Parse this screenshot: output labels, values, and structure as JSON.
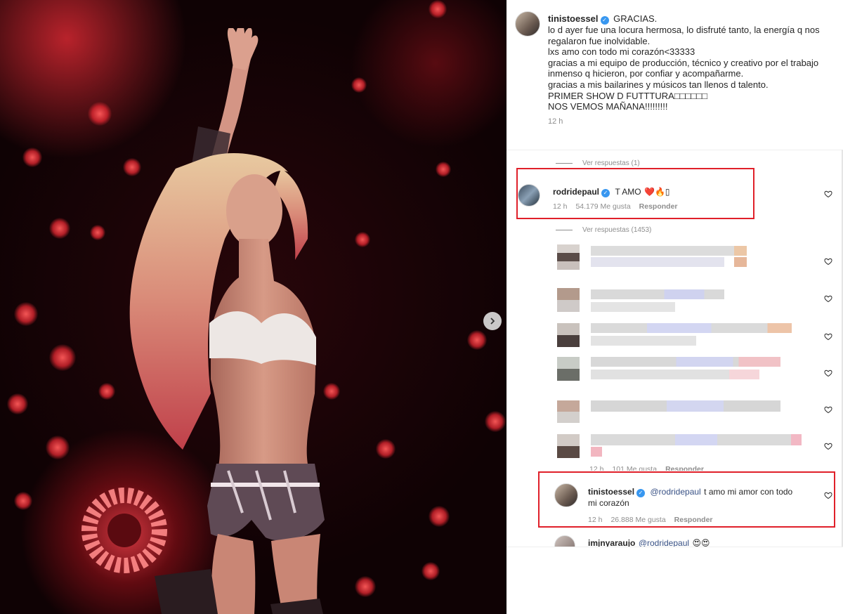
{
  "post": {
    "author": "tinistoessel",
    "caption_lines": [
      "GRACIAS.",
      "lo d ayer fue una locura hermosa, lo disfruté tanto, la energía q nos",
      "regalaron fue inolvidable.",
      "lxs amo con todo mi corazón<33333",
      "gracias a mi equipo de producción, técnico y creativo por el trabajo",
      "inmenso q hicieron, por confiar y acompañarme.",
      "gracias a mis bailarines y músicos tan llenos d talento.",
      "PRIMER SHOW D FUTTTURA□□□□□□",
      "NOS VEMOS MAÑANA!!!!!!!!!"
    ],
    "time": "12 h"
  },
  "replies_toggle_1": "Ver respuestas (1)",
  "comment_1": {
    "author": "rodridepaul",
    "text": "T AMO",
    "emoji": "❤️🔥▯",
    "time": "12 h",
    "likes": "54.179 Me gusta",
    "reply": "Responder"
  },
  "replies_toggle_2": "Ver respuestas (1453)",
  "blurred_row_meta": {
    "time": "12 h",
    "likes": "101 Me gusta",
    "reply": "Responder"
  },
  "comment_2": {
    "author": "tinistoessel",
    "mention": "@rodridepaul",
    "text_line1": "t amo mi amor con todo",
    "text_line2": "mi corazón",
    "time": "12 h",
    "likes": "26.888 Me gusta",
    "reply": "Responder"
  },
  "comment_3_partial": {
    "author": "imjnyaraujo",
    "mention": "@rodridepaul",
    "emoji": "😍😍"
  },
  "colors": {
    "highlight_box": "#e0202a",
    "verified_badge": "#3897f0",
    "mention": "#385185",
    "meta_gray": "#8e8e8e"
  },
  "icons": [
    "verified-badge-icon",
    "heart-icon",
    "chevron-right-icon"
  ]
}
